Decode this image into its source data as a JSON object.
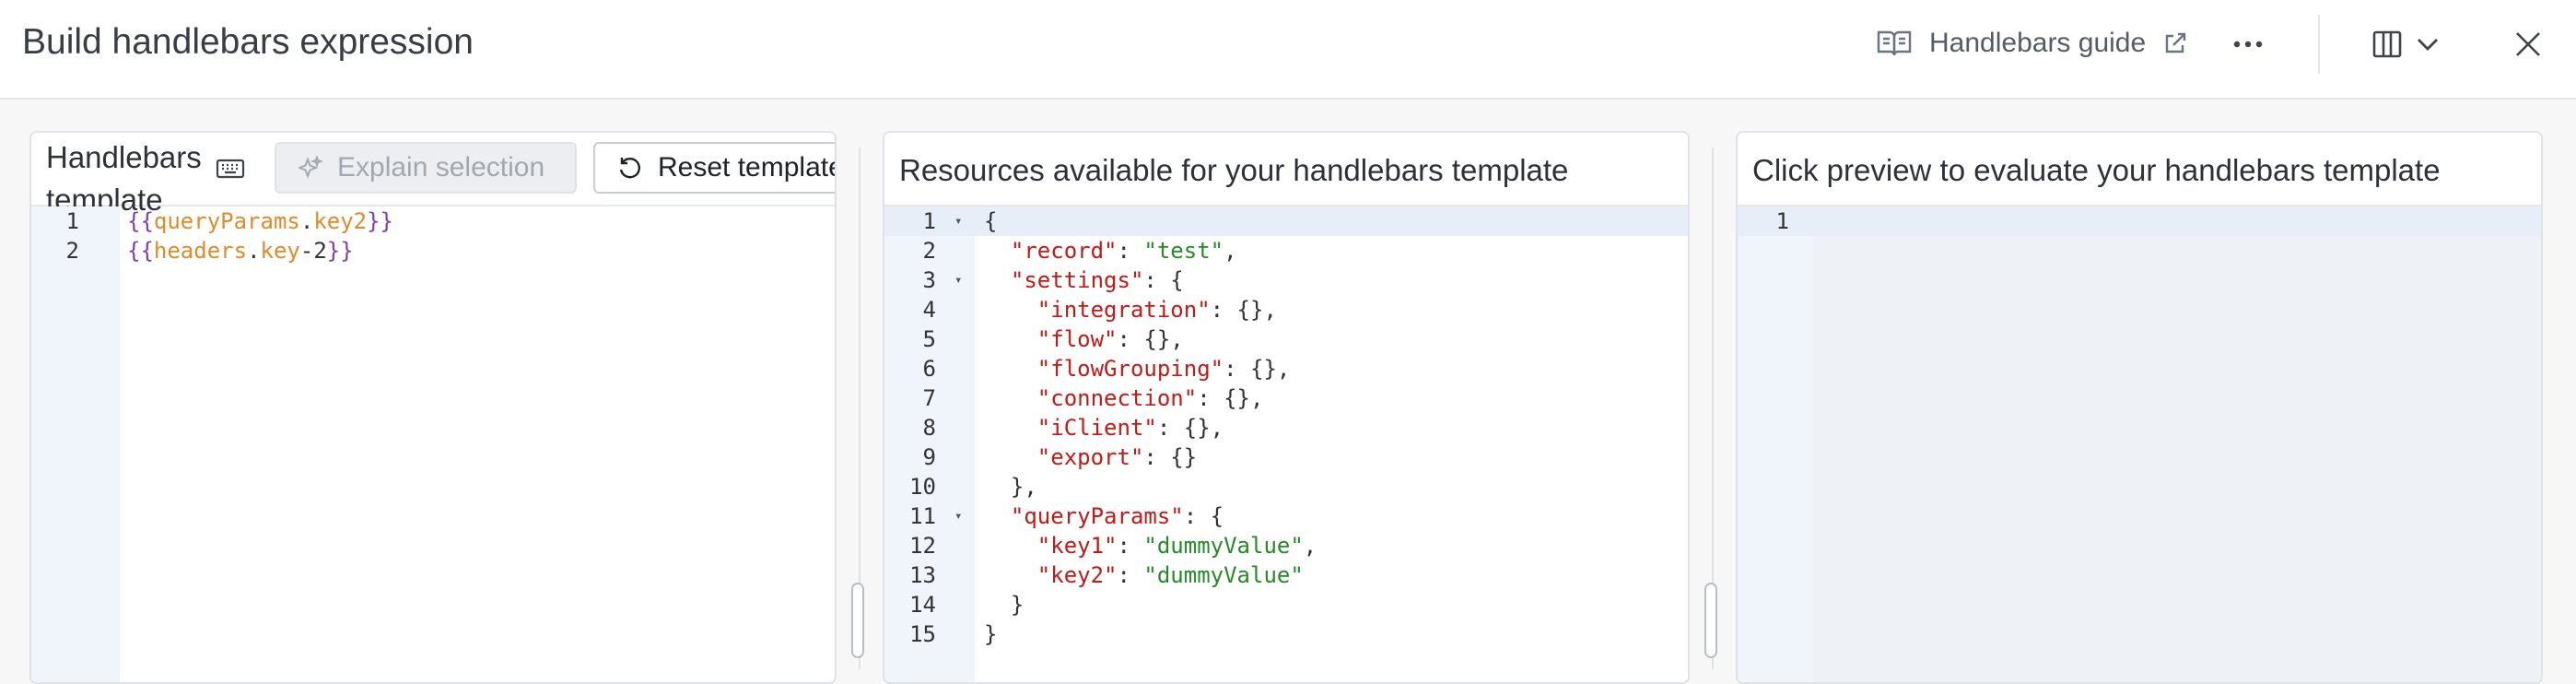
{
  "header": {
    "title": "Build handlebars expression",
    "guide_label": "Handlebars guide"
  },
  "left_panel": {
    "title": "Handlebars template",
    "explain_label": "Explain selection",
    "reset_label": "Reset template",
    "lines": [
      {
        "num": "1",
        "parts": [
          [
            "{{",
            "brace"
          ],
          [
            "queryParams",
            "var"
          ],
          [
            ".",
            "punct"
          ],
          [
            "key2",
            "var"
          ],
          [
            "}}",
            "brace"
          ]
        ]
      },
      {
        "num": "2",
        "parts": [
          [
            "{{",
            "brace"
          ],
          [
            "headers",
            "var"
          ],
          [
            ".",
            "punct"
          ],
          [
            "key",
            "var"
          ],
          [
            "-2",
            "punct"
          ],
          [
            "}}",
            "brace"
          ]
        ]
      }
    ]
  },
  "middle_panel": {
    "title": "Resources available for your handlebars template",
    "lines": [
      {
        "num": "1",
        "fold": true,
        "parts": [
          [
            "{",
            "punct"
          ]
        ]
      },
      {
        "num": "2",
        "parts": [
          [
            "  ",
            ""
          ],
          [
            "\"record\"",
            "key"
          ],
          [
            ": ",
            "punct"
          ],
          [
            "\"test\"",
            "str"
          ],
          [
            ",",
            "punct"
          ]
        ]
      },
      {
        "num": "3",
        "fold": true,
        "parts": [
          [
            "  ",
            ""
          ],
          [
            "\"settings\"",
            "key"
          ],
          [
            ": {",
            "punct"
          ]
        ]
      },
      {
        "num": "4",
        "parts": [
          [
            "    ",
            ""
          ],
          [
            "\"integration\"",
            "key"
          ],
          [
            ": {},",
            "punct"
          ]
        ]
      },
      {
        "num": "5",
        "parts": [
          [
            "    ",
            ""
          ],
          [
            "\"flow\"",
            "key"
          ],
          [
            ": {},",
            "punct"
          ]
        ]
      },
      {
        "num": "6",
        "parts": [
          [
            "    ",
            ""
          ],
          [
            "\"flowGrouping\"",
            "key"
          ],
          [
            ": {},",
            "punct"
          ]
        ]
      },
      {
        "num": "7",
        "parts": [
          [
            "    ",
            ""
          ],
          [
            "\"connection\"",
            "key"
          ],
          [
            ": {},",
            "punct"
          ]
        ]
      },
      {
        "num": "8",
        "parts": [
          [
            "    ",
            ""
          ],
          [
            "\"iClient\"",
            "key"
          ],
          [
            ": {},",
            "punct"
          ]
        ]
      },
      {
        "num": "9",
        "parts": [
          [
            "    ",
            ""
          ],
          [
            "\"export\"",
            "key"
          ],
          [
            ": {}",
            "punct"
          ]
        ]
      },
      {
        "num": "10",
        "parts": [
          [
            "  },",
            "punct"
          ]
        ]
      },
      {
        "num": "11",
        "fold": true,
        "parts": [
          [
            "  ",
            ""
          ],
          [
            "\"queryParams\"",
            "key"
          ],
          [
            ": {",
            "punct"
          ]
        ]
      },
      {
        "num": "12",
        "parts": [
          [
            "    ",
            ""
          ],
          [
            "\"key1\"",
            "key"
          ],
          [
            ": ",
            "punct"
          ],
          [
            "\"dummyValue\"",
            "str"
          ],
          [
            ",",
            "punct"
          ]
        ]
      },
      {
        "num": "13",
        "parts": [
          [
            "    ",
            ""
          ],
          [
            "\"key2\"",
            "key"
          ],
          [
            ": ",
            "punct"
          ],
          [
            "\"dummyValue\"",
            "str"
          ]
        ]
      },
      {
        "num": "14",
        "parts": [
          [
            "  }",
            "punct"
          ]
        ]
      },
      {
        "num": "15",
        "parts": [
          [
            "}",
            "punct"
          ]
        ]
      }
    ]
  },
  "right_panel": {
    "title": "Click preview to evaluate your handlebars template",
    "lines": [
      {
        "num": "1",
        "parts": []
      }
    ]
  }
}
